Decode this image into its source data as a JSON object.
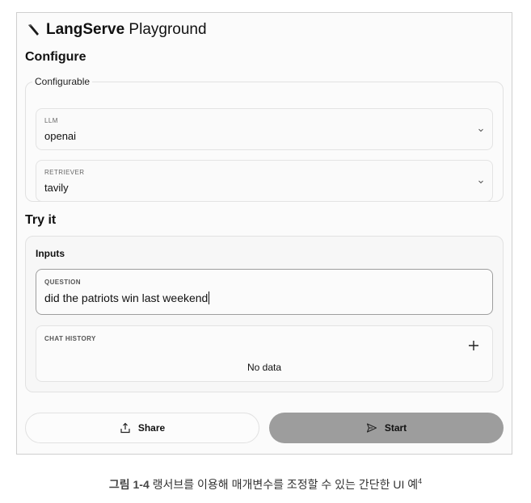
{
  "app": {
    "title_bold": "LangServe",
    "title_rest": " Playground"
  },
  "configure": {
    "heading": "Configure",
    "group_label": "Configurable",
    "fields": [
      {
        "label": "LLM",
        "value": "openai"
      },
      {
        "label": "RETRIEVER",
        "value": "tavily"
      }
    ]
  },
  "try_it": {
    "heading": "Try it",
    "inputs_title": "Inputs",
    "question": {
      "label": "QUESTION",
      "value": "did the patriots win last weekend"
    },
    "chat_history": {
      "label": "CHAT HISTORY",
      "empty_text": "No data"
    }
  },
  "actions": {
    "share_label": "Share",
    "start_label": "Start"
  },
  "caption": {
    "figure_label": "그림 1-4",
    "text": " 랭서브를 이용해 매개변수를 조정할 수 있는 간단한 UI 예",
    "footnote": "4"
  },
  "icons": [
    "langchain-parrot-icon",
    "chevron-down-icon",
    "plus-icon",
    "share-icon",
    "send-icon"
  ]
}
